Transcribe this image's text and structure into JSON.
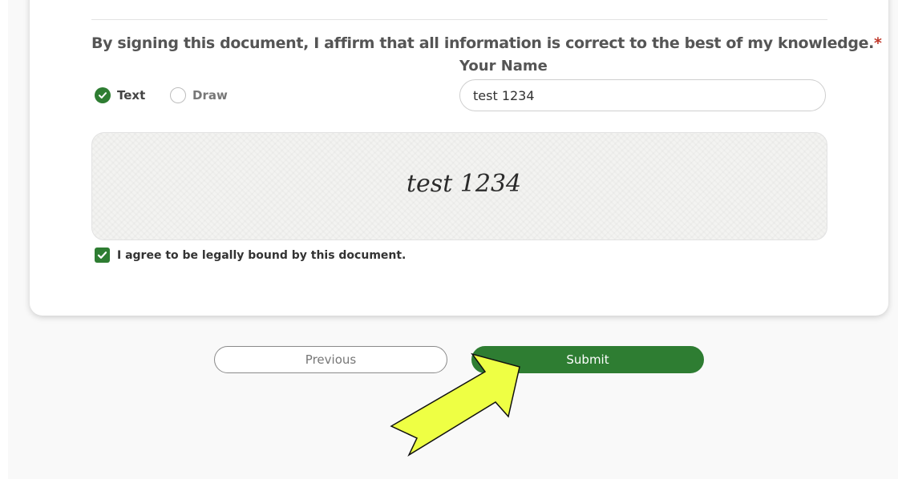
{
  "form": {
    "affirm_text": "By signing this document, I affirm that all information is correct to the best of my knowledge.",
    "required_marker": "*",
    "name_label": "Your Name",
    "name_value": "test 1234",
    "mode_options": [
      "Text",
      "Draw"
    ],
    "selected_mode": "Text",
    "signature_preview": "test 1234",
    "agree_label": "I agree to be legally bound by this document.",
    "agree_checked": true
  },
  "buttons": {
    "previous": "Previous",
    "submit": "Submit"
  },
  "colors": {
    "accent": "#2e7d32",
    "required": "#c0392b",
    "annotation_arrow": "#eeff44"
  },
  "icons": {
    "selected_radio": "check-circle-icon",
    "checkbox": "checkmark-icon",
    "annotation": "arrow-pointer-icon"
  }
}
